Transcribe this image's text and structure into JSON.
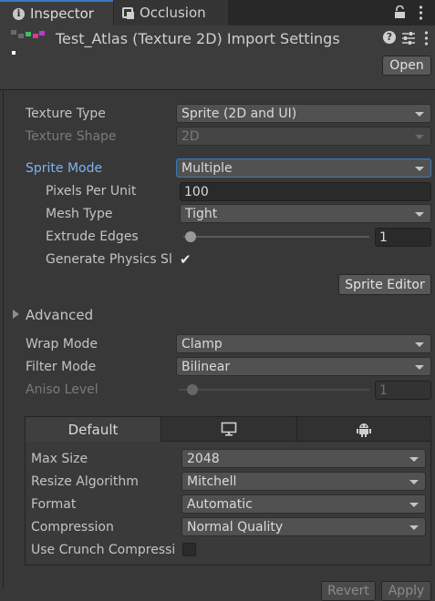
{
  "tabs": [
    {
      "label": "Inspector",
      "icon": "info-icon"
    },
    {
      "label": "Occlusion",
      "icon": "occlusion-icon"
    }
  ],
  "header": {
    "title": "Test_Atlas (Texture 2D) Import Settings",
    "open_label": "Open"
  },
  "fields": {
    "texture_type": {
      "label": "Texture Type",
      "value": "Sprite (2D and UI)"
    },
    "texture_shape": {
      "label": "Texture Shape",
      "value": "2D"
    },
    "sprite_mode": {
      "label": "Sprite Mode",
      "value": "Multiple"
    },
    "pixels_per_unit": {
      "label": "Pixels Per Unit",
      "value": "100"
    },
    "mesh_type": {
      "label": "Mesh Type",
      "value": "Tight"
    },
    "extrude_edges": {
      "label": "Extrude Edges",
      "value": "1"
    },
    "generate_physics": {
      "label": "Generate Physics Sl",
      "checked": true
    },
    "sprite_editor_label": "Sprite Editor",
    "advanced_label": "Advanced",
    "wrap_mode": {
      "label": "Wrap Mode",
      "value": "Clamp"
    },
    "filter_mode": {
      "label": "Filter Mode",
      "value": "Bilinear"
    },
    "aniso_level": {
      "label": "Aniso Level",
      "value": "1"
    }
  },
  "platform": {
    "tabs": [
      {
        "label": "Default",
        "icon": null
      },
      {
        "label": "",
        "icon": "monitor-icon"
      },
      {
        "label": "",
        "icon": "android-icon"
      }
    ],
    "max_size": {
      "label": "Max Size",
      "value": "2048"
    },
    "resize_algorithm": {
      "label": "Resize Algorithm",
      "value": "Mitchell"
    },
    "format": {
      "label": "Format",
      "value": "Automatic"
    },
    "compression": {
      "label": "Compression",
      "value": "Normal Quality"
    },
    "use_crunch": {
      "label": "Use Crunch Compressi",
      "checked": false
    }
  },
  "footer": {
    "revert_label": "Revert",
    "apply_label": "Apply"
  },
  "colors": {
    "accent": "#3a79bb",
    "label_blue": "#7fb3ee",
    "background": "#383838"
  }
}
